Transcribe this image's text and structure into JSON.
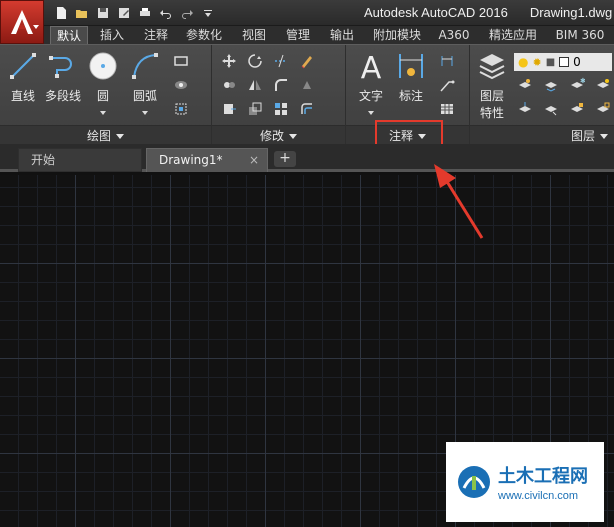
{
  "title_bar": {
    "app_name": "Autodesk AutoCAD 2016",
    "file_name": "Drawing1.dwg"
  },
  "quick_access": [
    "new-icon",
    "open-icon",
    "save-icon",
    "save-as-icon",
    "print-icon",
    "undo-icon",
    "redo-icon",
    "customize-icon"
  ],
  "ribbon_tabs": [
    "默认",
    "插入",
    "注释",
    "参数化",
    "视图",
    "管理",
    "输出",
    "附加模块",
    "A360",
    "精选应用",
    "BIM 360"
  ],
  "active_tab": "默认",
  "draw_panel": {
    "tools": [
      "直线",
      "多段线",
      "圆",
      "圆弧"
    ],
    "footer": "绘图"
  },
  "modify_panel": {
    "footer": "修改"
  },
  "annotation_panel": {
    "tools": [
      "文字",
      "标注"
    ],
    "footer": "注释"
  },
  "layers_panel": {
    "tools": [
      "图层",
      "特性"
    ],
    "layer_value": "0",
    "footer": "图层"
  },
  "doc_tabs": {
    "start": "开始",
    "drawing": "Drawing1*",
    "close": "×",
    "new": "+"
  },
  "watermark": {
    "title": "土木工程网",
    "url": "www.civilcn.com"
  },
  "colors": {
    "highlight": "#e43a2c",
    "app_button": "#c0302a",
    "canvas": "#121212"
  }
}
